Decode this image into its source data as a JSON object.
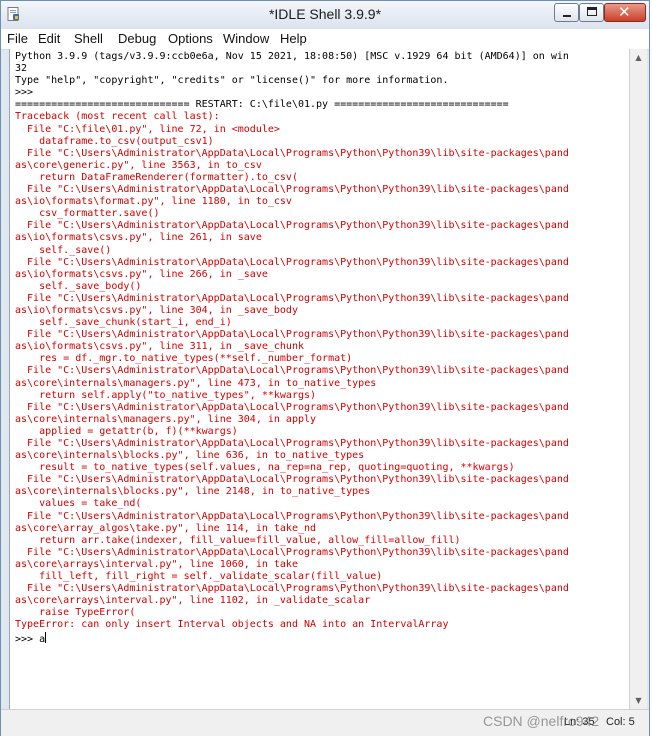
{
  "window": {
    "title": "*IDLE Shell 3.9.9*",
    "close_color": "#c7402a"
  },
  "menu": [
    "File",
    "Edit",
    "Shell",
    "Debug",
    "Options",
    "Window",
    "Help"
  ],
  "shell_lines": [
    {
      "type": "out",
      "text": "Python 3.9.9 (tags/v3.9.9:ccb0e6a, Nov 15 2021, 18:08:50) [MSC v.1929 64 bit (AMD64)] on win"
    },
    {
      "type": "out",
      "text": "32"
    },
    {
      "type": "out",
      "text": "Type \"help\", \"copyright\", \"credits\" or \"license()\" for more information."
    },
    {
      "type": "out",
      "text": ">>> "
    },
    {
      "type": "out",
      "text": "============================= RESTART: C:\\file\\01.py ============================="
    },
    {
      "type": "err",
      "text": "Traceback (most recent call last):"
    },
    {
      "type": "err",
      "text": "  File \"C:\\file\\01.py\", line 72, in <module>"
    },
    {
      "type": "err",
      "text": "    dataframe.to_csv(output_csv1)"
    },
    {
      "type": "err",
      "text": "  File \"C:\\Users\\Administrator\\AppData\\Local\\Programs\\Python\\Python39\\lib\\site-packages\\pand"
    },
    {
      "type": "err",
      "text": "as\\core\\generic.py\", line 3563, in to_csv"
    },
    {
      "type": "err",
      "text": "    return DataFrameRenderer(formatter).to_csv("
    },
    {
      "type": "err",
      "text": "  File \"C:\\Users\\Administrator\\AppData\\Local\\Programs\\Python\\Python39\\lib\\site-packages\\pand"
    },
    {
      "type": "err",
      "text": "as\\io\\formats\\format.py\", line 1180, in to_csv"
    },
    {
      "type": "err",
      "text": "    csv_formatter.save()"
    },
    {
      "type": "err",
      "text": "  File \"C:\\Users\\Administrator\\AppData\\Local\\Programs\\Python\\Python39\\lib\\site-packages\\pand"
    },
    {
      "type": "err",
      "text": "as\\io\\formats\\csvs.py\", line 261, in save"
    },
    {
      "type": "err",
      "text": "    self._save()"
    },
    {
      "type": "err",
      "text": "  File \"C:\\Users\\Administrator\\AppData\\Local\\Programs\\Python\\Python39\\lib\\site-packages\\pand"
    },
    {
      "type": "err",
      "text": "as\\io\\formats\\csvs.py\", line 266, in _save"
    },
    {
      "type": "err",
      "text": "    self._save_body()"
    },
    {
      "type": "err",
      "text": "  File \"C:\\Users\\Administrator\\AppData\\Local\\Programs\\Python\\Python39\\lib\\site-packages\\pand"
    },
    {
      "type": "err",
      "text": "as\\io\\formats\\csvs.py\", line 304, in _save_body"
    },
    {
      "type": "err",
      "text": "    self._save_chunk(start_i, end_i)"
    },
    {
      "type": "err",
      "text": "  File \"C:\\Users\\Administrator\\AppData\\Local\\Programs\\Python\\Python39\\lib\\site-packages\\pand"
    },
    {
      "type": "err",
      "text": "as\\io\\formats\\csvs.py\", line 311, in _save_chunk"
    },
    {
      "type": "err",
      "text": "    res = df._mgr.to_native_types(**self._number_format)"
    },
    {
      "type": "err",
      "text": "  File \"C:\\Users\\Administrator\\AppData\\Local\\Programs\\Python\\Python39\\lib\\site-packages\\pand"
    },
    {
      "type": "err",
      "text": "as\\core\\internals\\managers.py\", line 473, in to_native_types"
    },
    {
      "type": "err",
      "text": "    return self.apply(\"to_native_types\", **kwargs)"
    },
    {
      "type": "err",
      "text": "  File \"C:\\Users\\Administrator\\AppData\\Local\\Programs\\Python\\Python39\\lib\\site-packages\\pand"
    },
    {
      "type": "err",
      "text": "as\\core\\internals\\managers.py\", line 304, in apply"
    },
    {
      "type": "err",
      "text": "    applied = getattr(b, f)(**kwargs)"
    },
    {
      "type": "err",
      "text": "  File \"C:\\Users\\Administrator\\AppData\\Local\\Programs\\Python\\Python39\\lib\\site-packages\\pand"
    },
    {
      "type": "err",
      "text": "as\\core\\internals\\blocks.py\", line 636, in to_native_types"
    },
    {
      "type": "err",
      "text": "    result = to_native_types(self.values, na_rep=na_rep, quoting=quoting, **kwargs)"
    },
    {
      "type": "err",
      "text": "  File \"C:\\Users\\Administrator\\AppData\\Local\\Programs\\Python\\Python39\\lib\\site-packages\\pand"
    },
    {
      "type": "err",
      "text": "as\\core\\internals\\blocks.py\", line 2148, in to_native_types"
    },
    {
      "type": "err",
      "text": "    values = take_nd("
    },
    {
      "type": "err",
      "text": "  File \"C:\\Users\\Administrator\\AppData\\Local\\Programs\\Python\\Python39\\lib\\site-packages\\pand"
    },
    {
      "type": "err",
      "text": "as\\core\\array_algos\\take.py\", line 114, in take_nd"
    },
    {
      "type": "err",
      "text": "    return arr.take(indexer, fill_value=fill_value, allow_fill=allow_fill)"
    },
    {
      "type": "err",
      "text": "  File \"C:\\Users\\Administrator\\AppData\\Local\\Programs\\Python\\Python39\\lib\\site-packages\\pand"
    },
    {
      "type": "err",
      "text": "as\\core\\arrays\\interval.py\", line 1060, in take"
    },
    {
      "type": "err",
      "text": "    fill_left, fill_right = self._validate_scalar(fill_value)"
    },
    {
      "type": "err",
      "text": "  File \"C:\\Users\\Administrator\\AppData\\Local\\Programs\\Python\\Python39\\lib\\site-packages\\pand"
    },
    {
      "type": "err",
      "text": "as\\core\\arrays\\interval.py\", line 1102, in _validate_scalar"
    },
    {
      "type": "err",
      "text": "    raise TypeError("
    },
    {
      "type": "err",
      "text": "TypeError: can only insert Interval objects and NA into an IntervalArray"
    },
    {
      "type": "out",
      "text": ">>> a",
      "cursor": true
    }
  ],
  "status": {
    "line": "Ln: 35",
    "col": "Col: 5"
  },
  "watermark": "CSDN @nelfro942"
}
